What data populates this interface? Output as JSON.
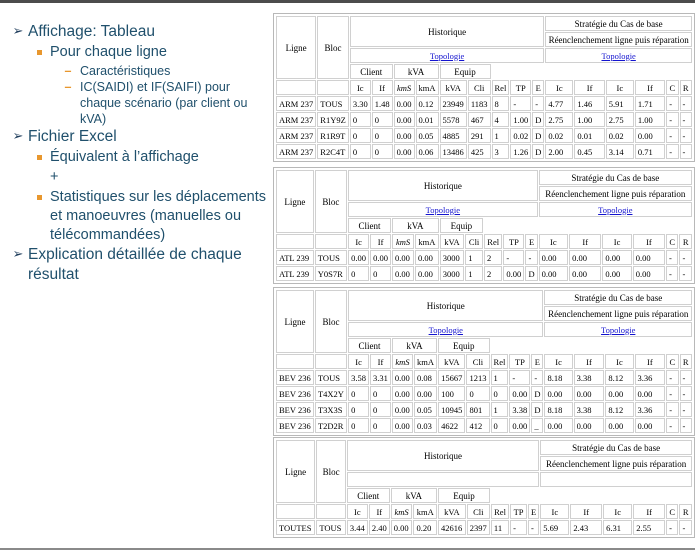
{
  "slide": {
    "outline": [
      {
        "level": 1,
        "marker": "arrow-bullet",
        "text": "Affichage: Tableau"
      },
      {
        "level": 2,
        "marker": "square-bullet",
        "text": "Pour chaque ligne"
      },
      {
        "level": 3,
        "marker": "dash-bullet",
        "text": "Caractéristiques"
      },
      {
        "level": 3,
        "marker": "dash-bullet",
        "text": "IC(SAIDI) et IF(SAIFI) pour chaque scénario (par client ou kVA)"
      },
      {
        "level": 1,
        "marker": "arrow-bullet",
        "text": "Fichier Excel"
      },
      {
        "level": 2,
        "marker": "square-bullet",
        "text": "Équivalent à l’affichage"
      },
      {
        "level": 2,
        "marker": "none",
        "text": "+"
      },
      {
        "level": 2,
        "marker": "square-bullet",
        "text": "Statistiques sur les déplacements et manoeuvres (manuelles ou télécommandées)"
      },
      {
        "level": 1,
        "marker": "arrow-bullet",
        "text": "Explication détaillée de chaque résultat"
      }
    ]
  },
  "table_common": {
    "row_label_headers": [
      "Ligne",
      "Bloc"
    ],
    "group_historique": "Historique",
    "group_strategie": "Stratégie du Cas de base",
    "group_reenclenchement": "Réenclenchement ligne puis réparation",
    "link_topologie": "Topologie",
    "sub_client": "Client",
    "sub_kva": "kVA",
    "sub_equip": "Equip",
    "hist_columns": [
      "Ic",
      "If",
      "kmS",
      "kmA",
      "kVA",
      "Cli",
      "Rel",
      "TP",
      "E"
    ],
    "strat_client_columns": [
      "Ic",
      "If"
    ],
    "strat_kva_columns": [
      "Ic",
      "If"
    ],
    "strat_equip_columns": [
      "C",
      "R"
    ]
  },
  "tables": [
    {
      "id": "table-arm-237",
      "has_topologie_links": true,
      "rows": [
        {
          "ligne": "ARM 237",
          "bloc": "TOUS",
          "hist": [
            "3.30",
            "1.48",
            "0.00",
            "0.12",
            "23949",
            "1183",
            "8",
            "-",
            "-"
          ],
          "client": [
            "4.77",
            "1.46"
          ],
          "kva": [
            "5.91",
            "1.71"
          ],
          "equip": [
            "-",
            "-"
          ]
        },
        {
          "ligne": "ARM 237",
          "bloc": "R1Y9Z",
          "hist": [
            "0",
            "0",
            "0.00",
            "0.01",
            "5578",
            "467",
            "4",
            "1.00",
            "D"
          ],
          "client": [
            "2.75",
            "1.00"
          ],
          "kva": [
            "2.75",
            "1.00"
          ],
          "equip": [
            "-",
            "-"
          ]
        },
        {
          "ligne": "ARM 237",
          "bloc": "R1R9T",
          "hist": [
            "0",
            "0",
            "0.00",
            "0.05",
            "4885",
            "291",
            "1",
            "0.02",
            "D"
          ],
          "client": [
            "0.02",
            "0.01"
          ],
          "kva": [
            "0.02",
            "0.00"
          ],
          "equip": [
            "-",
            "-"
          ]
        },
        {
          "ligne": "ARM 237",
          "bloc": "R2C4T",
          "hist": [
            "0",
            "0",
            "0.00",
            "0.06",
            "13486",
            "425",
            "3",
            "1.26",
            "D"
          ],
          "client": [
            "2.00",
            "0.45"
          ],
          "kva": [
            "3.14",
            "0.71"
          ],
          "equip": [
            "-",
            "-"
          ]
        }
      ]
    },
    {
      "id": "table-atl-239",
      "has_topologie_links": true,
      "rows": [
        {
          "ligne": "ATL 239",
          "bloc": "TOUS",
          "hist": [
            "0.00",
            "0.00",
            "0.00",
            "0.00",
            "3000",
            "1",
            "2",
            "-",
            "-"
          ],
          "client": [
            "0.00",
            "0.00"
          ],
          "kva": [
            "0.00",
            "0.00"
          ],
          "equip": [
            "-",
            "-"
          ]
        },
        {
          "ligne": "ATL 239",
          "bloc": "Y0S7R",
          "hist": [
            "0",
            "0",
            "0.00",
            "0.00",
            "3000",
            "1",
            "2",
            "0.00",
            "D"
          ],
          "client": [
            "0.00",
            "0.00"
          ],
          "kva": [
            "0.00",
            "0.00"
          ],
          "equip": [
            "-",
            "-"
          ]
        }
      ]
    },
    {
      "id": "table-bev-236",
      "has_topologie_links": true,
      "rows": [
        {
          "ligne": "BEV 236",
          "bloc": "TOUS",
          "hist": [
            "3.58",
            "3.31",
            "0.00",
            "0.08",
            "15667",
            "1213",
            "1",
            "-",
            "-"
          ],
          "client": [
            "8.18",
            "3.38"
          ],
          "kva": [
            "8.12",
            "3.36"
          ],
          "equip": [
            "-",
            "-"
          ]
        },
        {
          "ligne": "BEV 236",
          "bloc": "T4X2Y",
          "hist": [
            "0",
            "0",
            "0.00",
            "0.00",
            "100",
            "0",
            "0",
            "0.00",
            "D"
          ],
          "client": [
            "0.00",
            "0.00"
          ],
          "kva": [
            "0.00",
            "0.00"
          ],
          "equip": [
            "-",
            "-"
          ]
        },
        {
          "ligne": "BEV 236",
          "bloc": "T3X3S",
          "hist": [
            "0",
            "0",
            "0.00",
            "0.05",
            "10945",
            "801",
            "1",
            "3.38",
            "D"
          ],
          "client": [
            "8.18",
            "3.38"
          ],
          "kva": [
            "8.12",
            "3.36"
          ],
          "equip": [
            "-",
            "-"
          ]
        },
        {
          "ligne": "BEV 236",
          "bloc": "T2D2R",
          "hist": [
            "0",
            "0",
            "0.00",
            "0.03",
            "4622",
            "412",
            "0",
            "0.00",
            "_"
          ],
          "client": [
            "0.00",
            "0.00"
          ],
          "kva": [
            "0.00",
            "0.00"
          ],
          "equip": [
            "-",
            "-"
          ]
        }
      ]
    },
    {
      "id": "table-toutes",
      "has_topologie_links": false,
      "rows": [
        {
          "ligne": "TOUTES",
          "bloc": "TOUS",
          "hist": [
            "3.44",
            "2.40",
            "0.00",
            "0.20",
            "42616",
            "2397",
            "11",
            "-",
            "-"
          ],
          "client": [
            "5.69",
            "2.43"
          ],
          "kva": [
            "6.31",
            "2.55"
          ],
          "equip": [
            "-",
            "-"
          ]
        }
      ]
    }
  ]
}
